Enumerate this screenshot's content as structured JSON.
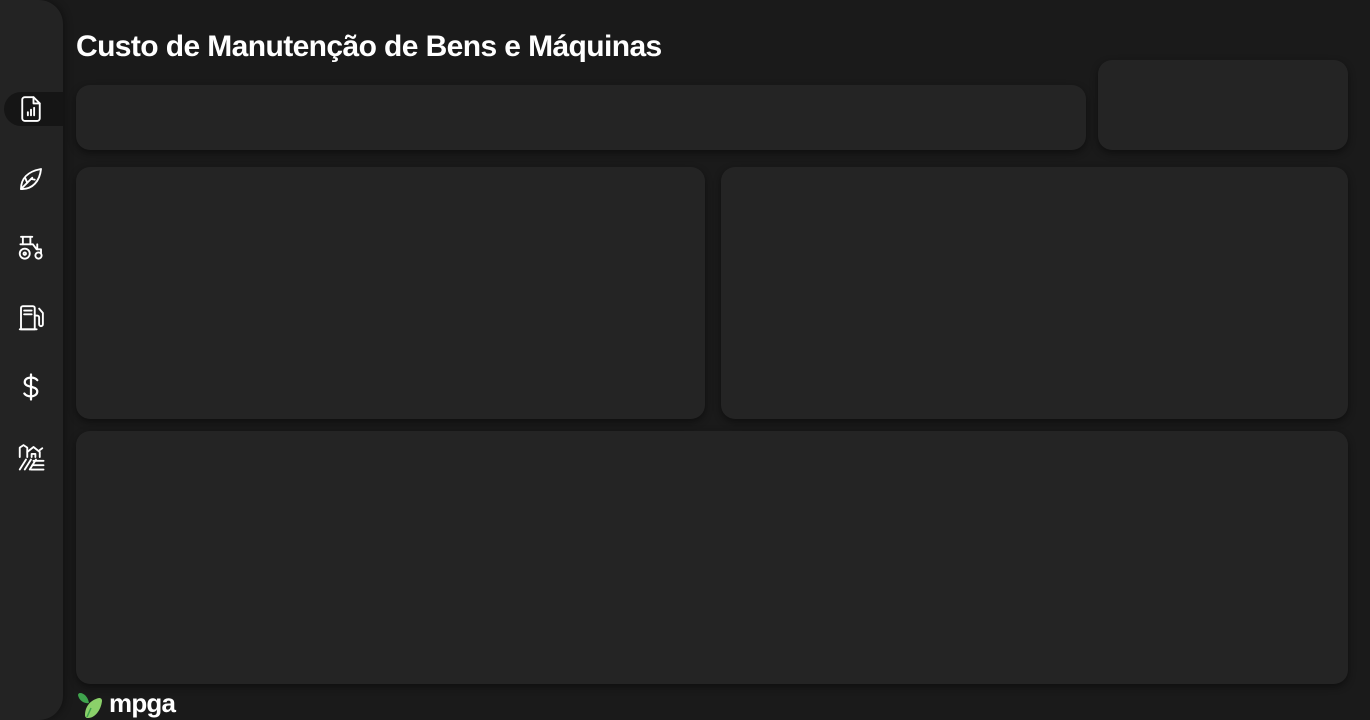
{
  "page": {
    "title": "Custo de Manutenção de Bens e Máquinas"
  },
  "sidebar": {
    "items": [
      {
        "icon": "report-chart-icon",
        "active": true
      },
      {
        "icon": "leaf-icon",
        "active": false
      },
      {
        "icon": "tractor-icon",
        "active": false
      },
      {
        "icon": "fuel-pump-icon",
        "active": false
      },
      {
        "icon": "dollar-icon",
        "active": false
      },
      {
        "icon": "farm-icon",
        "active": false
      }
    ]
  },
  "brand": {
    "name": "mpga",
    "colors": {
      "logo_green_dark": "#3fa34d",
      "logo_green_light": "#8bd16a"
    }
  },
  "theme": {
    "background": "#1a1a1a",
    "sidebar": "#232323",
    "card": "#242424",
    "active_nav": "#151515",
    "text": "#ffffff"
  }
}
